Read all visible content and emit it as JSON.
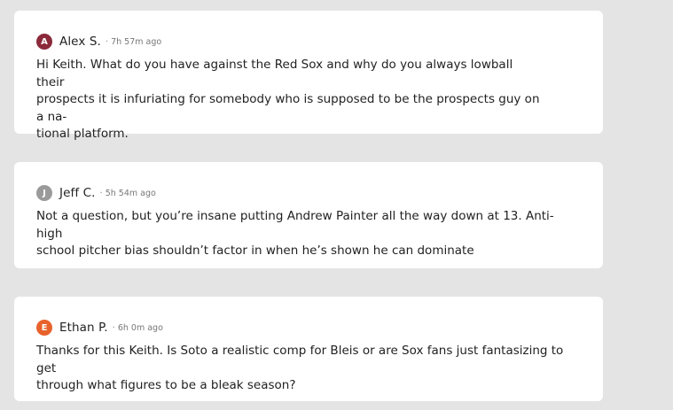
{
  "comments": [
    {
      "initial": "A",
      "avatar_color": "#8b2a3a",
      "author": "Alex S.",
      "separator": "·",
      "time": "7h 57m ago",
      "lines": [
        "Hi Keith. What do you have against the Red Sox and why do you always lowball their",
        "prospects it is infuriating for somebody who is supposed to be the prospects guy on a na-",
        "tional platform."
      ]
    },
    {
      "initial": "J",
      "avatar_color": "#9a9a9a",
      "author": "Jeff C.",
      "separator": "·",
      "time": "5h 54m ago",
      "lines": [
        "Not a question, but you’re insane putting Andrew Painter all the way down at 13. Anti-high",
        "school pitcher bias shouldn’t factor in when he’s shown he can dominate"
      ]
    },
    {
      "initial": "E",
      "avatar_color": "#e8622c",
      "author": "Ethan P.",
      "separator": "·",
      "time": "6h 0m ago",
      "lines": [
        "Thanks for this Keith. Is Soto a realistic comp for Bleis or are Sox fans just fantasizing to get",
        "through what figures to be a bleak season?"
      ]
    }
  ]
}
